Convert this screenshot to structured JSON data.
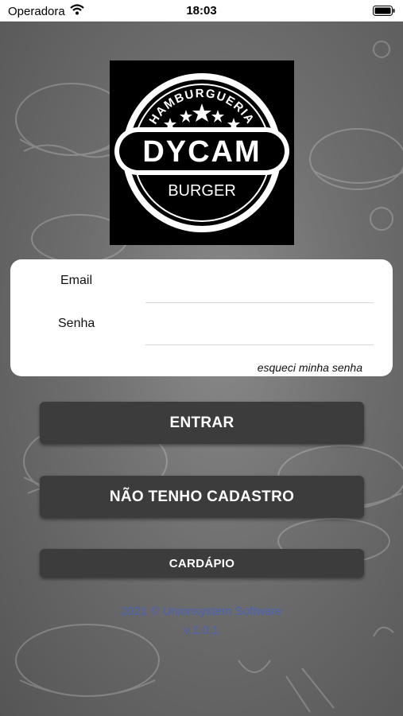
{
  "status_bar": {
    "carrier": "Operadora",
    "time": "18:03",
    "wifi_icon": "wifi-icon",
    "battery_icon": "battery-icon"
  },
  "logo": {
    "top_text": "HAMBURGUERIA",
    "main_text": "DYCAM",
    "bottom_text": "BURGER"
  },
  "login_form": {
    "email_label": "Email",
    "email_value": "",
    "password_label": "Senha",
    "password_value": "",
    "forgot_password": "esqueci minha senha"
  },
  "buttons": {
    "login": "ENTRAR",
    "register": "NÃO TENHO CADASTRO",
    "menu": "CARDÁPIO"
  },
  "footer": {
    "copyright": "2021 © Unionsystem Software",
    "version": "v.1.0.1"
  },
  "colors": {
    "button_bg": "#3c3c3c",
    "footer_text": "#4a62b8",
    "card_bg": "#ffffff"
  }
}
